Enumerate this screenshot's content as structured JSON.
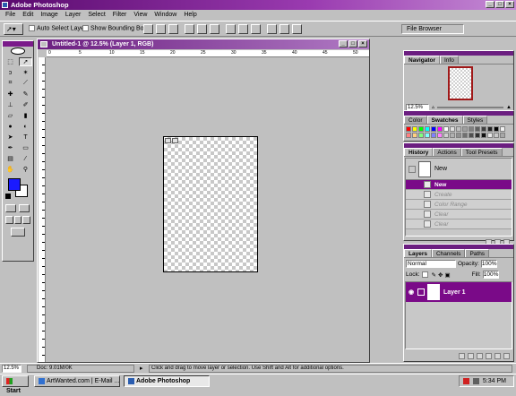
{
  "app": {
    "title": "Adobe Photoshop"
  },
  "menu": [
    "File",
    "Edit",
    "Image",
    "Layer",
    "Select",
    "Filter",
    "View",
    "Window",
    "Help"
  ],
  "options": {
    "auto_select": "Auto Select Layer",
    "show_bbox": "Show Bounding Box",
    "file_browser": "File Browser"
  },
  "document": {
    "title": "Untitled-1 @ 12.5% (Layer 1, RGB)",
    "ruler_marks": [
      "0",
      "5",
      "10",
      "15",
      "20",
      "25",
      "30",
      "35",
      "40",
      "45",
      "50"
    ]
  },
  "navigator": {
    "tabs": [
      "Navigator",
      "Info"
    ],
    "zoom": "12.5%"
  },
  "color_panel": {
    "tabs": [
      "Color",
      "Swatches",
      "Styles"
    ]
  },
  "history": {
    "tabs": [
      "History",
      "Actions",
      "Tool Presets"
    ],
    "snapshot": "New",
    "items": [
      "New",
      "Create",
      "Color Range",
      "Clear",
      "Clear",
      "Clear"
    ]
  },
  "layers": {
    "tabs": [
      "Layers",
      "Channels",
      "Paths"
    ],
    "blend_mode": "Normal",
    "opacity_label": "Opacity:",
    "opacity": "100%",
    "lock_label": "Lock:",
    "fill_label": "Fill:",
    "fill": "100%",
    "layer_name": "Layer 1"
  },
  "status": {
    "zoom": "12.5%",
    "doc": "Doc: 9.01M/0K",
    "hint": "Click and drag to move layer or selection.  Use Shift and Alt for additional options."
  },
  "taskbar": {
    "start": "Start",
    "task1": "ArtWanted.com | E-Mail ...",
    "task2": "Adobe Photoshop",
    "clock": "5:34 PM"
  },
  "colors": {
    "foreground": "#1a1aff",
    "background": "#ffffff",
    "accent": "#7a0a88"
  }
}
